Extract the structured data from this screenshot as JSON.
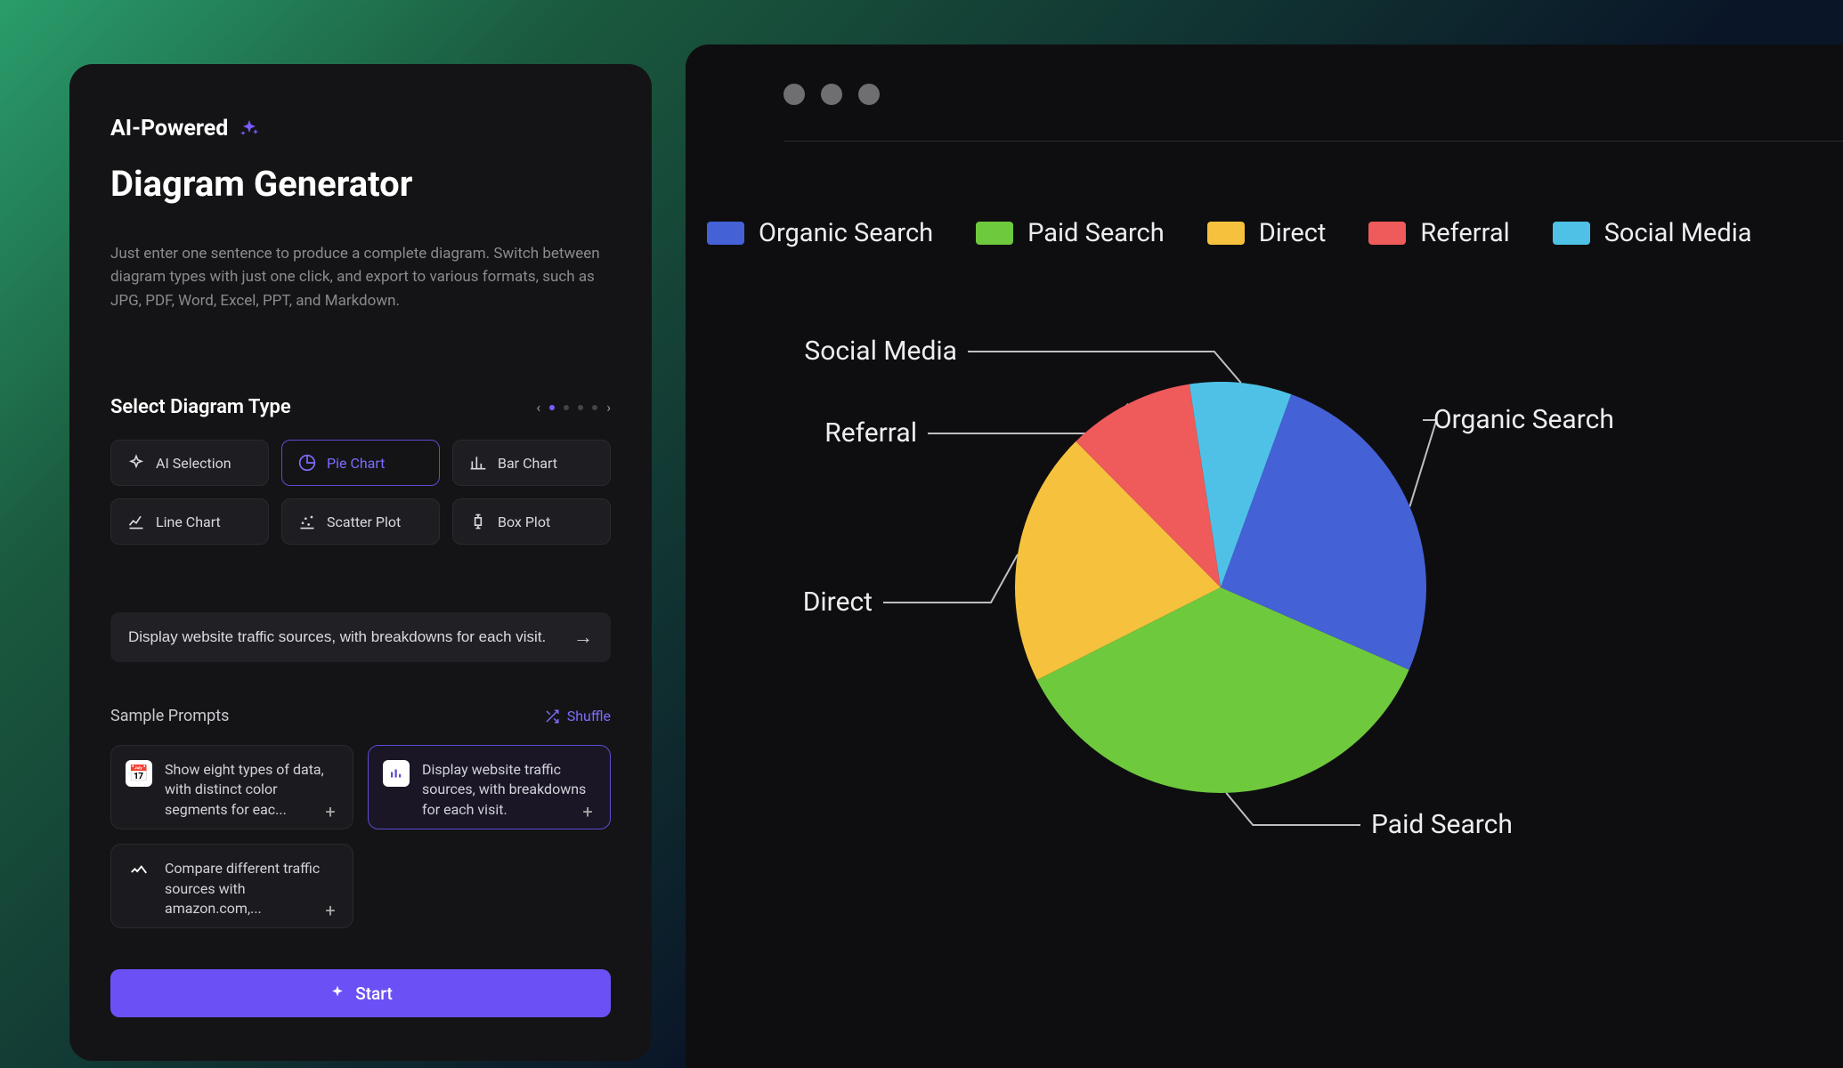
{
  "left": {
    "badge": "AI-Powered",
    "title": "Diagram Generator",
    "subtitle": "Just enter one sentence to produce a complete diagram. Switch between diagram types with just one click, and export to various formats, such as JPG, PDF, Word, Excel, PPT, and Markdown.",
    "section_label": "Select Diagram Type",
    "types": [
      {
        "label": "AI Selection",
        "selected": false
      },
      {
        "label": "Pie Chart",
        "selected": true
      },
      {
        "label": "Bar Chart",
        "selected": false
      },
      {
        "label": "Line Chart",
        "selected": false
      },
      {
        "label": "Scatter Plot",
        "selected": false
      },
      {
        "label": "Box Plot",
        "selected": false
      }
    ],
    "prompt_value": "Display website traffic sources, with breakdowns for each visit.",
    "samples_label": "Sample Prompts",
    "shuffle_label": "Shuffle",
    "samples": [
      {
        "text": "Show eight types of data, with distinct color segments for eac...",
        "selected": false
      },
      {
        "text": "Display website traffic sources, with breakdowns for each visit.",
        "selected": true
      },
      {
        "text": "Compare different traffic sources with amazon.com,...",
        "selected": false
      }
    ],
    "start_label": "Start"
  },
  "chart_data": {
    "type": "pie",
    "title": "",
    "categories": [
      "Organic Search",
      "Paid Search",
      "Direct",
      "Referral",
      "Social Media"
    ],
    "values": [
      26,
      36,
      20,
      10,
      8
    ],
    "colors": [
      "#4461d6",
      "#6ec93d",
      "#f6c23d",
      "#ef5a5a",
      "#4fc1e7"
    ]
  },
  "colors": {
    "accent": "#6b51f5",
    "accent_text": "#7c6cff"
  }
}
